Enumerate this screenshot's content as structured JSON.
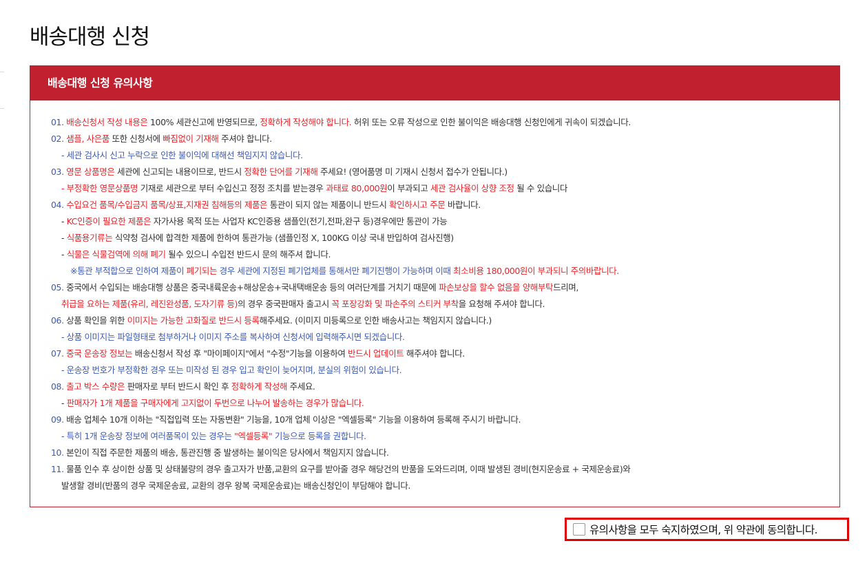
{
  "page": {
    "title": "배송대행 신청"
  },
  "notice": {
    "header": "배송대행 신청 유의사항",
    "items": {
      "n01": {
        "num": "01.",
        "a": "배송신청서 작성 내용은",
        "b": " 100% 세관신고에 반영되므로, ",
        "c": "정확하게 작성해야 합니다.",
        "d": " 허위 또는 오류 작성으로 인한 불이익은 배송대행 신청인에게 귀속이 되겠습니다."
      },
      "n02": {
        "num": "02.",
        "a": "샘플, 사은품",
        "b": " 또한 신청서에 ",
        "c": "빠짐없이 기재해",
        "d": " 주셔야 합니다.",
        "s1": "- 세관 검사시 신고 누락으로 인한 불이익에 대해선 책임지지 않습니다."
      },
      "n03": {
        "num": "03.",
        "a": "영문 상품명은",
        "b": " 세관에 신고되는 내용이므로, 반드시 ",
        "c": "정확한 단어를 기재해",
        "d": " 주세요! (영어품명 미 기재시 신청서 접수가 안됩니다.)",
        "s1a": "- 부정확한 영문상품명",
        "s1b": " 기재로 세관으로 부터 수입신고 정정 조치를 받는경우 ",
        "s1c": "과태료 80,000원",
        "s1d": "이 부과되고 ",
        "s1e": "세관 검사율이 상향 조정",
        "s1f": " 될 수 있습니다"
      },
      "n04": {
        "num": "04.",
        "a": "수입요건 품목/수입금지 품목/상표,지재권 침해등의 제품은",
        "b": " 통관이 되지 않는 제품이니 반드시 ",
        "c": "확인하시고 주문",
        "d": " 바랍니다.",
        "s1a": "- ",
        "s1b": "KC인증이 필요한 제품은",
        "s1c": " 자가사용 목적 또는 사업자 KC인증용 샘플인(전기,전파,완구 등)경우에만 통관이 가능",
        "s2a": "- ",
        "s2b": "식품용기류는",
        "s2c": " 식약청 검사에 합격한 제품에 한하여 통관가능 (샘플인정 X, 100KG 이상 국내 반입하여 검사진행)",
        "s3a": "- ",
        "s3b": "식물은 식물검역에 의해 폐기",
        "s3c": " 될수 있으니 수입전 반드시 문의 해주셔 합니다.",
        "s4a": "※통관 부적합으로 인하여 제품이 ",
        "s4b": "폐기되는",
        "s4c": " 경우 세관에 지정된 폐기업체를 통해서만 폐기진행이 가능하며 이때 ",
        "s4d": "최소비용 180,000원이 부과되니 주의바랍니다."
      },
      "n05": {
        "num": "05.",
        "a": " 중국에서 수입되는 배송대행 상품은 중국내륙운송+해상운송+국내택배운송 등의 여러단계를 거치기 때문에 ",
        "b": "파손보상을 할수 없음을 양해부탁",
        "c": "드리며,",
        "s1a": "취급을 요하는 제품(유리, 레진완성품, 도자기류 등)",
        "s1b": "의 경우 중국판매자 출고시 ",
        "s1c": "꼭 포장강화 및 파손주의 스티커 부착",
        "s1d": "을 요청해 주셔야 합니다."
      },
      "n06": {
        "num": "06.",
        "a": " 상품 확인을 위한 ",
        "b": "이미지는 가능한 고화질로 반드시 등록",
        "c": "해주세요. (이미지 미등록으로 인한 배송사고는 책임지지 않습니다.)",
        "s1": "-  상품 이미지는 파일형태로 첨부하거나 이미지 주소를 복사하여 신청서에 입력해주시면 되겠습니다."
      },
      "n07": {
        "num": "07.",
        "a": "중국 운송장 정보는",
        "b": " 배송신청서 작성 후 \"마이페이지\"에서 \"수정\"기능을 이용하여 ",
        "c": "반드시 업데이트",
        "d": " 해주셔야 합니다.",
        "s1": "- 운송장 번호가 부정확한 경우 또는 미작성 된 경우 입고 확인이 늦어지며, 분실의 위험이 있습니다."
      },
      "n08": {
        "num": "08.",
        "a": "출고 박스 수량은",
        "b": " 판매자로 부터 반드시 확인 후 ",
        "c": "정확하게 작성해",
        "d": " 주세요.",
        "s1a": "- ",
        "s1b": "판매자가 1개 제품을 구매자에게 고지없이 두번으로 나누어 발송하는 경우가 많습니다."
      },
      "n09": {
        "num": "09.",
        "a": " 배송 업체수 10개 이하는 \"직접입력 또는 자동변환\" 기능을, 10개 업체 이상은 \"엑셀등록\" 기능을 이용하여 등록해 주시기 바랍니다.",
        "s1a": "- 특히 1개 운송장 정보에 여러품목이 있는 경우는 ",
        "s1b": "\"엑셀등록\"",
        "s1c": " 기능으로 등록을 권합니다."
      },
      "n10": {
        "num": "10.",
        "a": " 본인이 직접 주문한 제품의 배송, 통관진행 중 발생하는 불이익은 당사에서 책임지지 않습니다."
      },
      "n11": {
        "num": "11.",
        "a": " 물품 인수 후 상이한 상품 및 상태불량의 경우 출고자가 반품,교환의 요구를 받아줄 경우 해당건의 반품을 도와드리며, 이때 발생된 경비(현지운송료 + 국제운송료)와",
        "s1": "발생할 경비(반품의 경우 국제운송료, 교환의 경우 왕복 국제운송료)는 배송신청인이 부담해야 합니다."
      }
    }
  },
  "agree": {
    "label": "유의사항을 모두 숙지하였으며, 위 약관에 동의합니다."
  }
}
